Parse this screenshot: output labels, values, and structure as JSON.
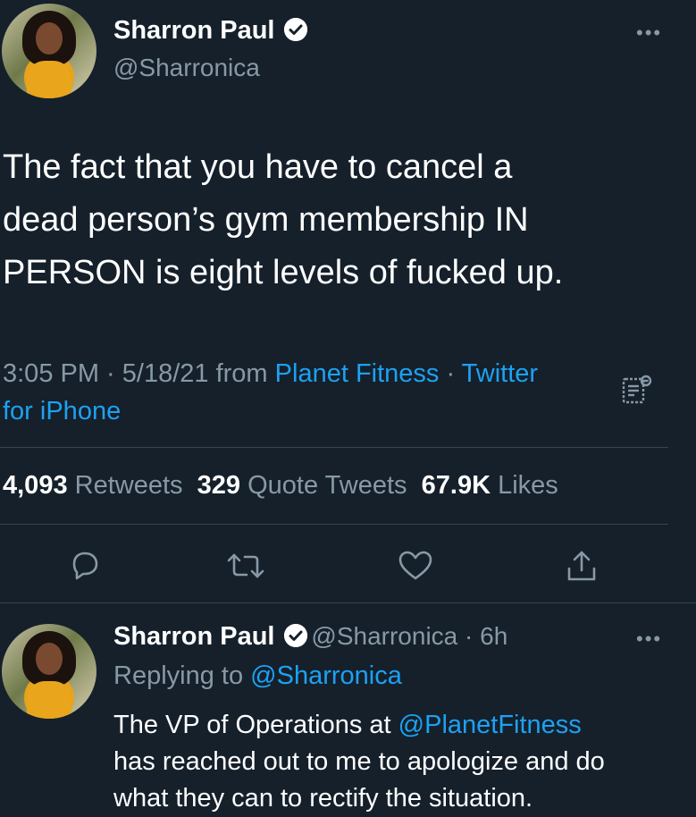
{
  "main_tweet": {
    "author_name": "Sharron Paul",
    "author_handle": "@Sharronica",
    "text_lines": [
      "The fact that you have to cancel a",
      "dead person’s gym membership IN",
      "PERSON is eight levels of fucked up."
    ],
    "time": "3:05 PM · 5/18/21 from ",
    "location": "Planet Fitness",
    "separator": " · ",
    "source_part1": "Twitter",
    "source_part2": "for iPhone",
    "stats": {
      "retweets_count": "4,093",
      "retweets_label": "Retweets",
      "quotes_count": "329",
      "quotes_label": "Quote Tweets",
      "likes_count": "67.9K",
      "likes_label": "Likes"
    },
    "more_label": "•••"
  },
  "reply_tweet": {
    "author_name": "Sharron Paul",
    "author_handle": "@Sharronica",
    "age": " · 6h",
    "replying_prefix": "Replying to ",
    "replying_handle": "@Sharronica",
    "line1_prefix": "The VP of Operations at ",
    "line1_mention": "@PlanetFitness",
    "line2": "has reached out to me to apologize and do",
    "line3": "what they can to rectify the situation.",
    "more_label": "•••"
  },
  "colors": {
    "background": "#15202b",
    "accent": "#1da1f2",
    "secondary_text": "#8899a6",
    "divider": "#38444d"
  }
}
